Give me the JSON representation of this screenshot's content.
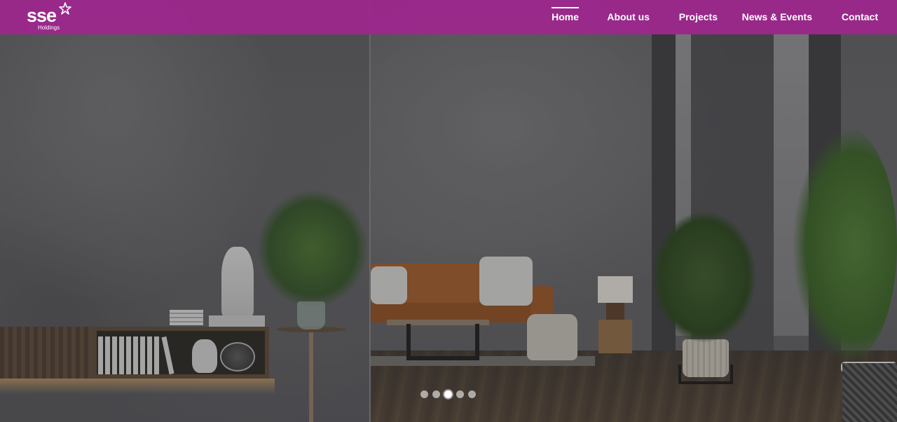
{
  "brand": {
    "logo_text": "sse",
    "logo_subtext": "Holdings",
    "logo_icon": "star-icon",
    "accent_color": "#a0268e"
  },
  "nav": {
    "items": [
      {
        "label": "Home",
        "active": true
      },
      {
        "label": "About us",
        "active": false
      },
      {
        "label": "Projects",
        "active": false
      },
      {
        "label": "News & Events",
        "active": false
      },
      {
        "label": "Contact",
        "active": false
      }
    ]
  },
  "carousel": {
    "slide_count": 5,
    "active_index": 2
  }
}
